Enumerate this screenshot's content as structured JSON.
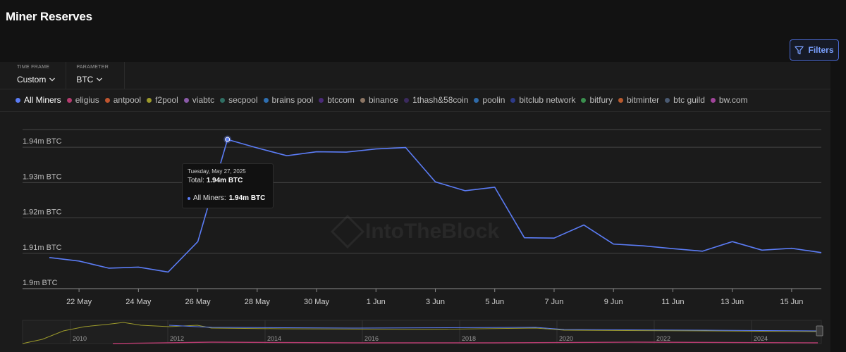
{
  "page": {
    "title": "Miner Reserves"
  },
  "toolbar": {
    "filters_label": "Filters"
  },
  "controls": {
    "time_frame": {
      "label": "TIME FRAME",
      "value": "Custom"
    },
    "parameter": {
      "label": "PARAMETER",
      "value": "BTC"
    }
  },
  "legend": [
    {
      "label": "All Miners",
      "color": "#5b7cf5",
      "active": true
    },
    {
      "label": "eligius",
      "color": "#b43b6e"
    },
    {
      "label": "antpool",
      "color": "#c0552f"
    },
    {
      "label": "f2pool",
      "color": "#9c9a2b"
    },
    {
      "label": "viabtc",
      "color": "#8a5aa8"
    },
    {
      "label": "secpool",
      "color": "#2f6e63"
    },
    {
      "label": "brains pool",
      "color": "#2e6eb0"
    },
    {
      "label": "btccom",
      "color": "#4a2a78"
    },
    {
      "label": "binance",
      "color": "#8c7563"
    },
    {
      "label": "1thash&58coin",
      "color": "#3b2a5e"
    },
    {
      "label": "poolin",
      "color": "#2f6aa8"
    },
    {
      "label": "bitclub network",
      "color": "#2d3a88"
    },
    {
      "label": "bitfury",
      "color": "#3a8f4e"
    },
    {
      "label": "bitminter",
      "color": "#b85a2e"
    },
    {
      "label": "btc guild",
      "color": "#4a5a72"
    },
    {
      "label": "bw.com",
      "color": "#a0449a"
    }
  ],
  "tooltip": {
    "date": "Tuesday, May 27, 2025",
    "total_prefix": "Total: ",
    "total_value": "1.94m BTC",
    "series_prefix": "All Miners: ",
    "series_value": "1.94m BTC"
  },
  "watermark": "IntoTheBlock",
  "chart_data": {
    "type": "line",
    "ylim": [
      1.9,
      1.945
    ],
    "y_ticks": [
      {
        "value": 1.94,
        "label": "1.94m BTC"
      },
      {
        "value": 1.93,
        "label": "1.93m BTC"
      },
      {
        "value": 1.92,
        "label": "1.92m BTC"
      },
      {
        "value": 1.91,
        "label": "1.91m BTC"
      },
      {
        "value": 1.9,
        "label": "1.9m BTC"
      }
    ],
    "x_ticks": [
      "22 May",
      "24 May",
      "26 May",
      "28 May",
      "30 May",
      "1 Jun",
      "3 Jun",
      "5 Jun",
      "7 Jun",
      "9 Jun",
      "11 Jun",
      "13 Jun",
      "15 Jun"
    ],
    "x": [
      "21 May",
      "22 May",
      "23 May",
      "24 May",
      "25 May",
      "26 May",
      "27 May",
      "28 May",
      "29 May",
      "30 May",
      "31 May",
      "1 Jun",
      "2 Jun",
      "3 Jun",
      "4 Jun",
      "5 Jun",
      "6 Jun",
      "7 Jun",
      "8 Jun",
      "9 Jun",
      "10 Jun",
      "11 Jun",
      "12 Jun",
      "13 Jun",
      "14 Jun",
      "15 Jun",
      "16 Jun"
    ],
    "series": [
      {
        "name": "All Miners",
        "color": "#5b7cf5",
        "values": [
          1.9088,
          1.9078,
          1.9058,
          1.9061,
          1.9047,
          1.9133,
          1.9422,
          1.9398,
          1.9376,
          1.9387,
          1.9386,
          1.9395,
          1.9399,
          1.9302,
          1.9277,
          1.9287,
          1.9144,
          1.9143,
          1.918,
          1.9126,
          1.9121,
          1.9113,
          1.9106,
          1.9133,
          1.9109,
          1.9114,
          1.9102
        ]
      }
    ],
    "grid": true,
    "highlight_index": 6,
    "navigator": {
      "x_labels": [
        "2010",
        "2012",
        "2014",
        "2016",
        "2018",
        "2020",
        "2022",
        "2024"
      ]
    }
  }
}
